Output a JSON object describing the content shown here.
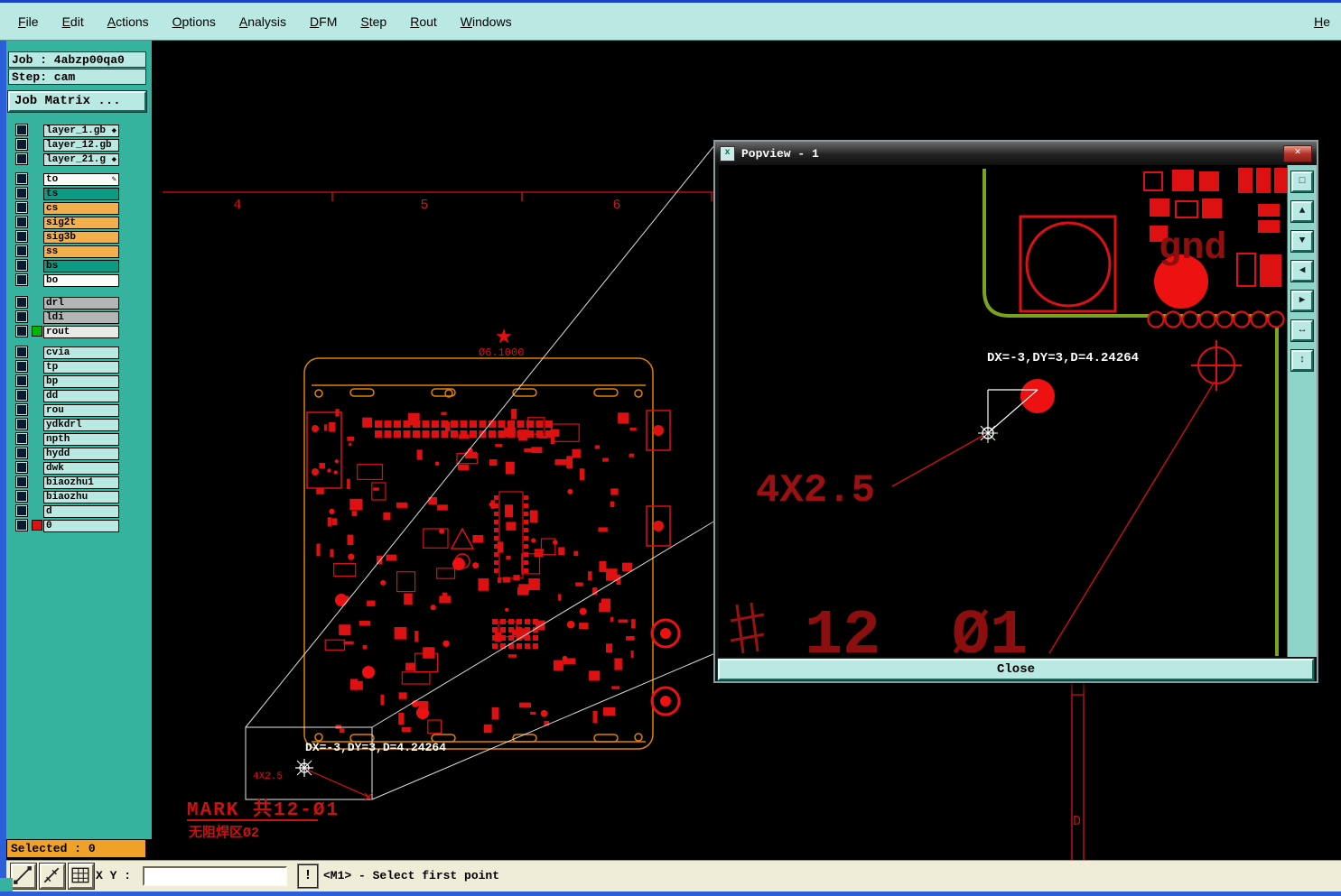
{
  "colors": {
    "frame_blue": "#2b5fd9",
    "teal_panel": "#35b39f",
    "light_panel": "#b9e9e2",
    "selected_orange": "#f0a128",
    "layer_orange": "#f2b04b",
    "layer_teal": "#0b9a83",
    "pcb_red": "#dd1111",
    "board_outline_orange": "#e08000",
    "trace_green": "#79a41e",
    "statusbar_cream": "#efecd8"
  },
  "menu": {
    "items": [
      "File",
      "Edit",
      "Actions",
      "Options",
      "Analysis",
      "DFM",
      "Step",
      "Rout",
      "Windows"
    ],
    "right_item": "He"
  },
  "job_panel": {
    "job_line": "Job : 4abzp00qa0",
    "step_line": "Step: cam",
    "matrix_button": "Job Matrix ..."
  },
  "layers": {
    "groups": [
      {
        "rows": [
          {
            "name": "layer_1.gb",
            "suffix": "◆",
            "color": "cyan"
          },
          {
            "name": "layer_12.gb",
            "suffix": "",
            "color": "cyan"
          },
          {
            "name": "layer_21.g",
            "suffix": "◆",
            "color": "cyan"
          }
        ]
      },
      {
        "rows": [
          {
            "name": "to",
            "suffix": "✎",
            "color": "white"
          },
          {
            "name": "ts",
            "color": "teal"
          },
          {
            "name": "cs",
            "color": "orange"
          },
          {
            "name": "sig2t",
            "color": "orange"
          },
          {
            "name": "sig3b",
            "color": "orange"
          },
          {
            "name": "ss",
            "color": "orange"
          },
          {
            "name": "bs",
            "color": "teal"
          },
          {
            "name": "bo",
            "color": "white"
          }
        ]
      },
      {
        "rows": [
          {
            "name": "drl",
            "color": "gray"
          },
          {
            "name": "ldi",
            "color": "gray"
          },
          {
            "name": "rout",
            "color": "light",
            "active": "green"
          }
        ]
      },
      {
        "rows": [
          {
            "name": "cvia",
            "color": "cyan"
          },
          {
            "name": "tp",
            "color": "cyan"
          },
          {
            "name": "bp",
            "color": "cyan"
          },
          {
            "name": "dd",
            "color": "cyan"
          },
          {
            "name": "rou",
            "color": "cyan"
          },
          {
            "name": "ydkdrl",
            "color": "cyan"
          },
          {
            "name": "npth",
            "color": "cyan"
          },
          {
            "name": "hydd",
            "color": "cyan"
          },
          {
            "name": "dwk",
            "color": "cyan"
          },
          {
            "name": "biaozhu1",
            "color": "cyan"
          },
          {
            "name": "biaozhu",
            "color": "cyan"
          },
          {
            "name": "d",
            "color": "cyan"
          },
          {
            "name": "0",
            "color": "cyan",
            "active": "red"
          }
        ]
      }
    ]
  },
  "canvas": {
    "ruler_numbers": [
      "4",
      "5",
      "6"
    ],
    "diameter_note": "Ø6.1000",
    "measure_text": "DX=-3,DY=3,D=4.24264",
    "dim_label": "4X2.5",
    "mark_line": "MARK 共12-Ø1",
    "mask_line": "无阻焊区Ø2",
    "d_label": "D"
  },
  "popview": {
    "title": "Popview - 1",
    "close_glyph": "✕",
    "close_label": "Close",
    "gnd_label": "gnd",
    "measure_text": "DX=-3,DY=3,D=4.24264",
    "dim_label": "4X2.5",
    "big_number": "12",
    "big_diameter": "Ø1",
    "tools": [
      {
        "name": "view-window-icon",
        "glyph": "□"
      },
      {
        "name": "pan-up-icon",
        "glyph": "▲"
      },
      {
        "name": "pan-down-icon",
        "glyph": "▼"
      },
      {
        "name": "pan-left-icon",
        "glyph": "◀"
      },
      {
        "name": "pan-right-icon",
        "glyph": "▶"
      },
      {
        "name": "zoom-horizontal-icon",
        "glyph": "↔"
      },
      {
        "name": "zoom-vertical-icon",
        "glyph": "↕"
      }
    ]
  },
  "statusbar": {
    "selected_label": "Selected : 0",
    "xy_label": "X Y :",
    "coord_value": "",
    "alert_button": "!",
    "message": "<M1> - Select first point",
    "tool_icons": [
      "line-tool-icon",
      "measure-tool-icon",
      "grid-tool-icon"
    ]
  }
}
